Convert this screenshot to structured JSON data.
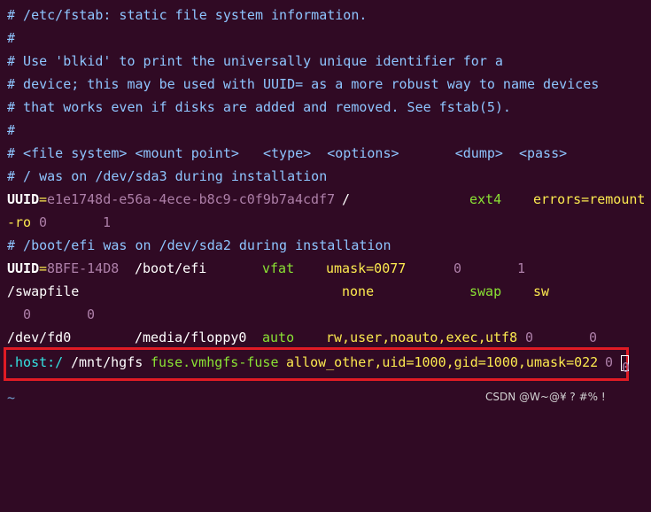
{
  "terminal": {
    "lines": [
      {
        "text": "# /etc/fstab: static file system information."
      },
      {
        "text": "#"
      },
      {
        "text": "# Use 'blkid' to print the universally unique identifier for a"
      },
      {
        "text": "# device; this may be used with UUID= as a more robust way to name devices"
      },
      {
        "text": "# that works even if disks are added and removed. See fstab(5)."
      },
      {
        "text": "#"
      },
      {
        "text": "# <file system> <mount point>   <type>  <options>       <dump>  <pass>"
      },
      {
        "text": "# / was on /dev/sda3 during installation"
      }
    ],
    "uuid_root": {
      "key": "UUID",
      "eq": "=",
      "value": "e1e1748d-e56a-4ece-b8c9-c0f9b7a4cdf7",
      "mount": "/",
      "type": "ext4",
      "options": "errors=remount",
      "wrap_options": "-ro",
      "dump": "0",
      "pass": "1"
    },
    "comment_boot": "# /boot/efi was on /dev/sda2 during installation",
    "uuid_boot": {
      "key": "UUID",
      "eq": "=",
      "value": "8BFE-14D8",
      "mount": "/boot/efi",
      "type": "vfat",
      "options": "umask=0077",
      "dump": "0",
      "pass": "1"
    },
    "swap": {
      "device": "/swapfile",
      "mount": "none",
      "type": "swap",
      "options": "sw",
      "dump": "0",
      "pass": "0"
    },
    "fd0": {
      "device": "/dev/fd0",
      "mount": "/media/floppy0",
      "type": "auto",
      "options_a": "rw,user,noauto,exec,",
      "options_b": "utf8",
      "dump": "0",
      "pass": "0"
    },
    "host": {
      "device": ".host:/",
      "mount": "/mnt/hgfs",
      "type": "fuse.vmhgfs-fuse",
      "options": "allow_other,uid=1000,gid=1000,umask=022",
      "dump": "0",
      "pass": "0"
    },
    "tilde": "~"
  },
  "watermark": "CSDN @W~@¥ ? #% !",
  "colors": {
    "background": "#300a24",
    "comment": "#8ec5ff",
    "type": "#8ae234",
    "option": "#fce94f",
    "number": "#ad7fa8",
    "highlight": "#e01b24"
  }
}
